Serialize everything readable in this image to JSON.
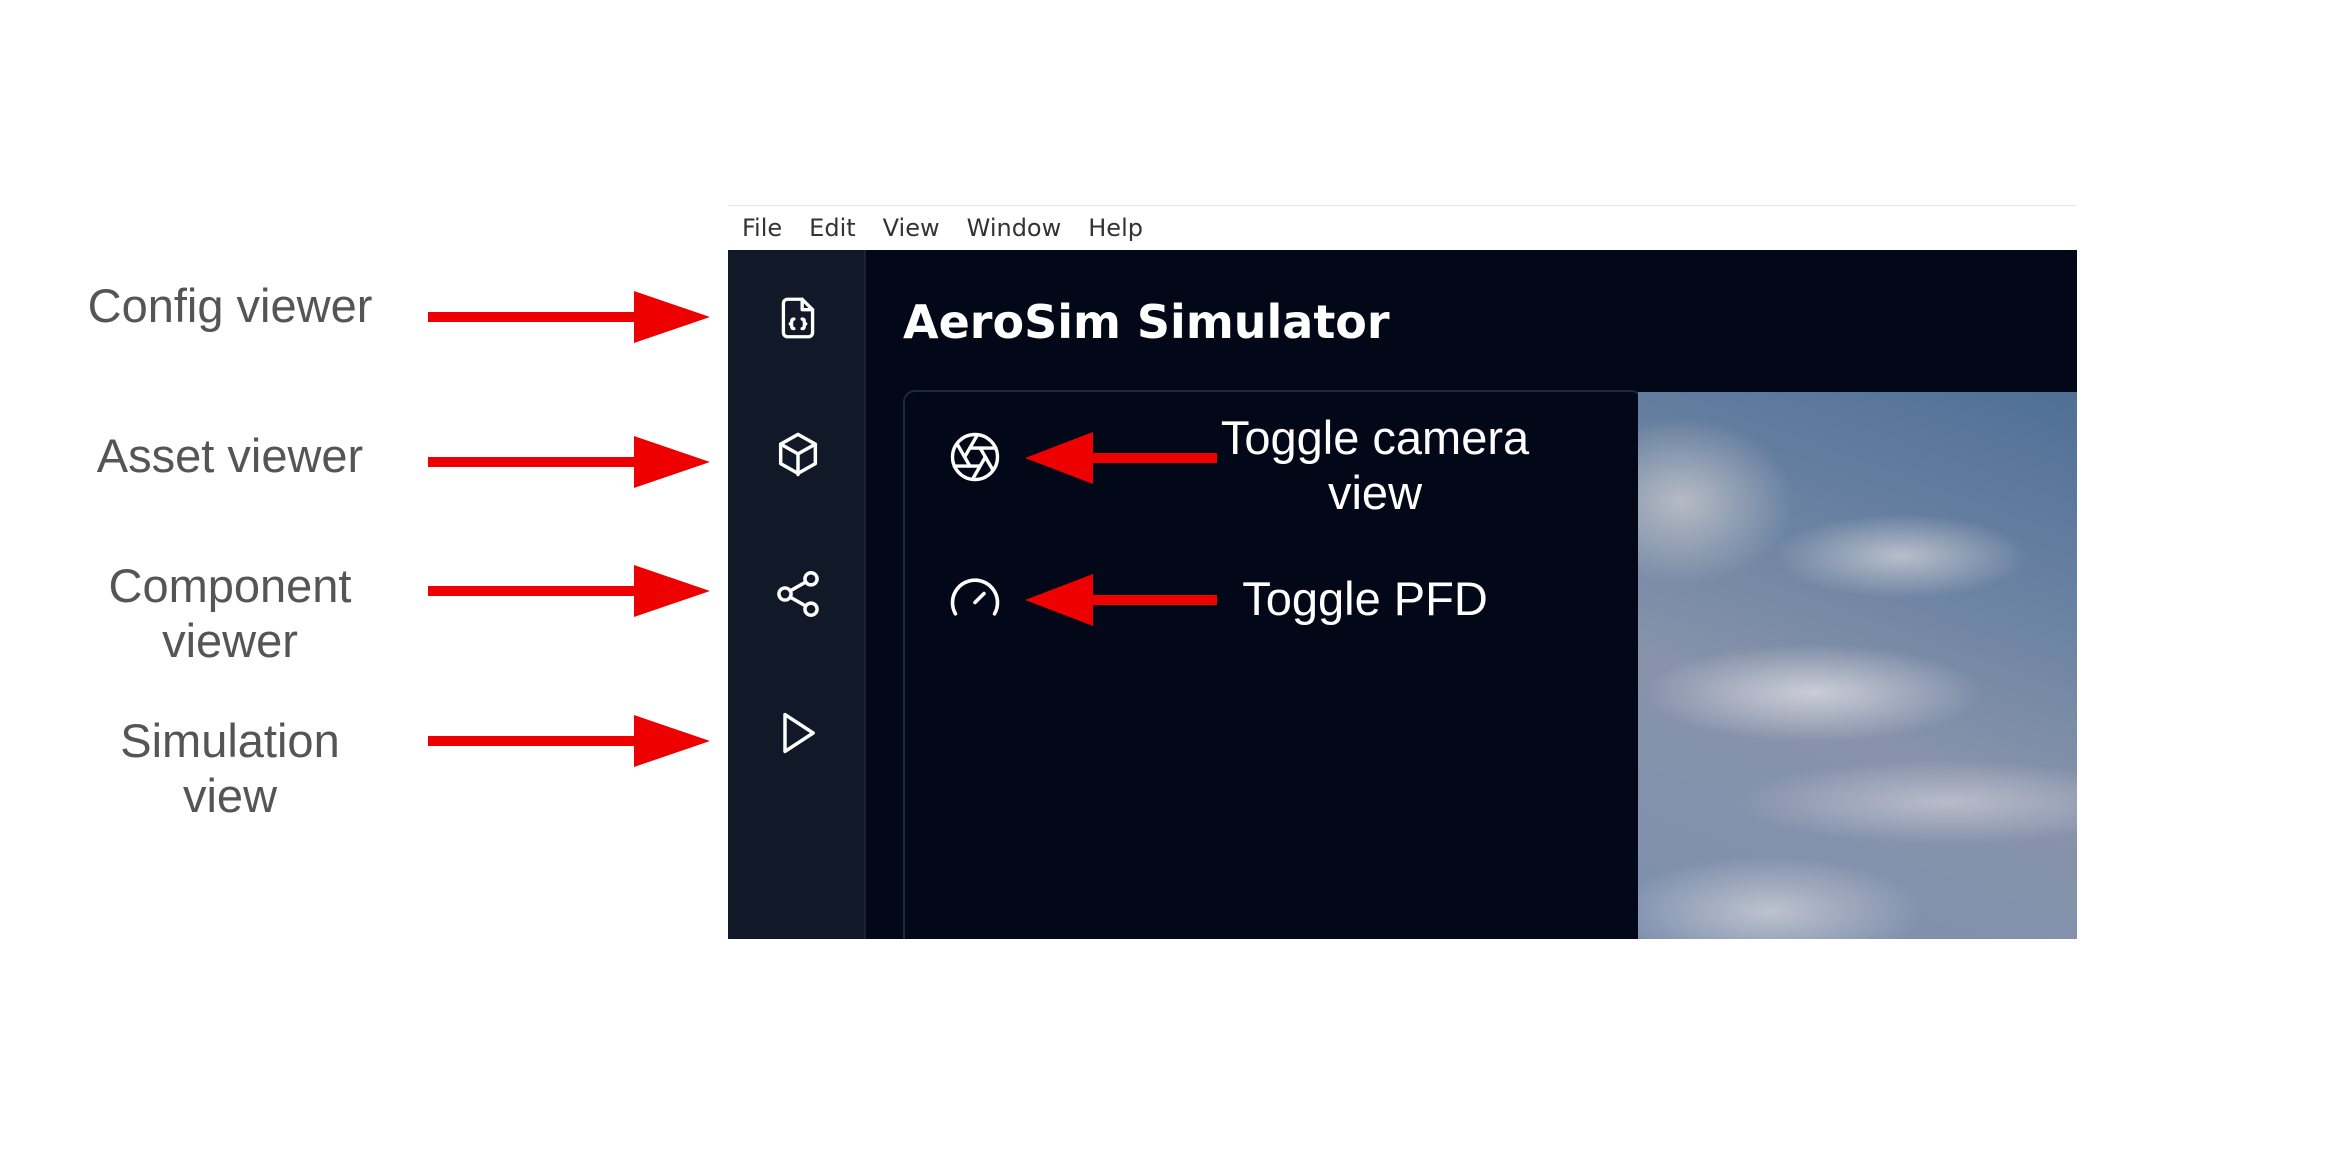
{
  "annotations": {
    "config_viewer": "Config viewer",
    "asset_viewer": "Asset viewer",
    "component_viewer": "Component viewer",
    "simulation_view": "Simulation view",
    "toggle_camera_view": "Toggle camera view",
    "toggle_pfd": "Toggle PFD",
    "arrow_color": "#ee0000",
    "label_color": "#555555"
  },
  "menu": {
    "file": "File",
    "edit": "Edit",
    "view": "View",
    "window": "Window",
    "help": "Help"
  },
  "app": {
    "title": "AeroSim Simulator",
    "background": "#020817",
    "sidebar_background": "#111827"
  },
  "icons": {
    "sidebar": [
      "file-code-icon",
      "box-icon",
      "share-icon",
      "play-icon"
    ],
    "panel": [
      "aperture-icon",
      "gauge-icon"
    ]
  }
}
